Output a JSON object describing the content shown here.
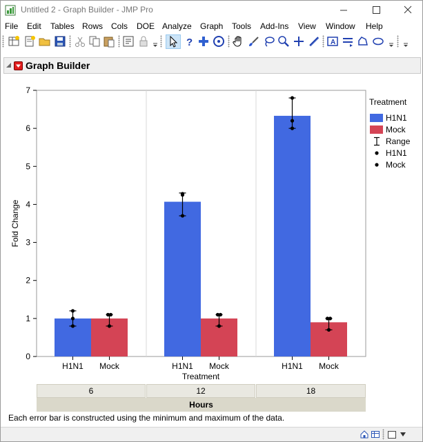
{
  "window": {
    "title": "Untitled 2 - Graph Builder - JMP Pro",
    "icon": "jmp-app-icon"
  },
  "menu": [
    "File",
    "Edit",
    "Tables",
    "Rows",
    "Cols",
    "DOE",
    "Analyze",
    "Graph",
    "Tools",
    "Add-Ins",
    "View",
    "Window",
    "Help"
  ],
  "report": {
    "title": "Graph Builder"
  },
  "legend": {
    "title": "Treatment",
    "items": [
      {
        "label": "H1N1",
        "kind": "swatch",
        "color": "#4169e1"
      },
      {
        "label": "Mock",
        "kind": "swatch",
        "color": "#d44455"
      },
      {
        "label": "Range",
        "kind": "error-bar"
      },
      {
        "label": "H1N1",
        "kind": "point"
      },
      {
        "label": "Mock",
        "kind": "point"
      }
    ]
  },
  "chart_data": {
    "type": "bar",
    "ylabel": "Fold Change",
    "xlabel": "Treatment",
    "ylim": [
      0,
      7
    ],
    "yticks": [
      0,
      1,
      2,
      3,
      4,
      5,
      6,
      7
    ],
    "grid": false,
    "legend_position": "right",
    "group_by": "Hours",
    "groups": [
      "6",
      "12",
      "18"
    ],
    "categories": [
      "H1N1",
      "Mock"
    ],
    "colors": {
      "H1N1": "#4169e1",
      "Mock": "#d44455"
    },
    "series": [
      {
        "name": "H1N1",
        "values": [
          1.0,
          4.07,
          6.33
        ],
        "range": [
          [
            0.8,
            1.2
          ],
          [
            3.7,
            4.3
          ],
          [
            6.0,
            6.8
          ]
        ],
        "points": [
          [
            0.8,
            1.0,
            1.2
          ],
          [
            3.7,
            4.25,
            4.28
          ],
          [
            6.0,
            6.2,
            6.8
          ]
        ]
      },
      {
        "name": "Mock",
        "values": [
          1.0,
          1.0,
          0.9
        ],
        "range": [
          [
            0.8,
            1.1
          ],
          [
            0.8,
            1.1
          ],
          [
            0.7,
            1.0
          ]
        ],
        "points": [
          [
            0.8,
            1.1,
            1.1
          ],
          [
            0.8,
            1.1,
            1.1
          ],
          [
            0.7,
            1.0,
            1.0
          ]
        ]
      }
    ]
  },
  "footnote": "Each error bar is constructed using the minimum and maximum of the data."
}
